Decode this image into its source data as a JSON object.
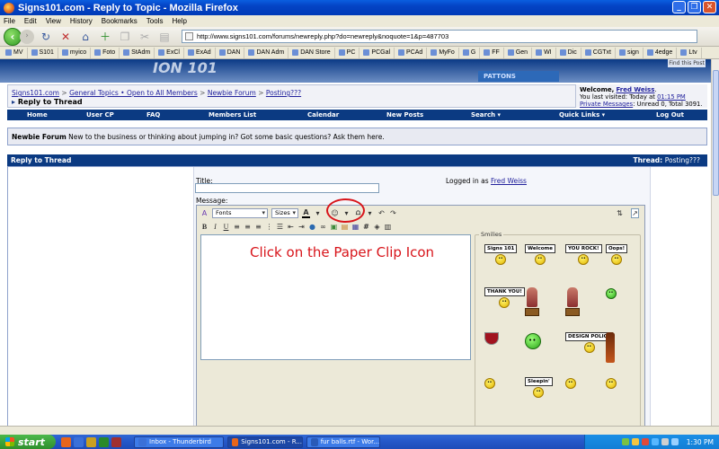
{
  "window": {
    "title": "Signs101.com - Reply to Topic - Mozilla Firefox"
  },
  "menubar": [
    "File",
    "Edit",
    "View",
    "History",
    "Bookmarks",
    "Tools",
    "Help"
  ],
  "navbar": {
    "url": "http://www.signs101.com/forums/newreply.php?do=newreply&noquote=1&p=487703"
  },
  "bookmarks": [
    "MV",
    "S101",
    "myico",
    "Foto",
    "StAdm",
    "ExCl",
    "ExAd",
    "DAN",
    "DAN Adm",
    "DAN Store",
    "PC",
    "PCGal",
    "PCAd",
    "MyFo",
    "G",
    "FF",
    "Gen",
    "WI",
    "Dic",
    "CGTxt",
    "sign",
    "4edge",
    "Ltv"
  ],
  "header": {
    "find_label": "Find this Post",
    "mid_label": "PATTONS"
  },
  "breadcrumb": {
    "items": [
      "Signs101.com",
      "General Topics • Open to All Members",
      "Newbie Forum",
      "Posting???"
    ],
    "separator": ">",
    "page_title": "Reply to Thread"
  },
  "welcome": {
    "greeting": "Welcome,",
    "user": "Fred Weiss",
    "last_visited_prefix": "You last visited: Today at",
    "last_visited_time": "01:15 PM",
    "pm_link": "Private Messages",
    "pm_counts": ": Unread 0, Total 3091."
  },
  "menu": [
    "Home",
    "User CP",
    "FAQ",
    "Members List",
    "Calendar",
    "New Posts",
    "Search ▾",
    "Quick Links ▾",
    "Log Out"
  ],
  "forum": {
    "name": "Newbie Forum",
    "description": "New to the business or thinking about jumping in? Got some basic questions? Ask them here."
  },
  "reply": {
    "bar_label": "Reply to Thread",
    "thread_label": "Thread:",
    "thread_name": "Posting???"
  },
  "form": {
    "title_label": "Title:",
    "message_label": "Message:",
    "logged_in_prefix": "Logged in as",
    "logged_in_user": "Fred Weiss"
  },
  "editor": {
    "fonts_label": "Fonts",
    "sizes_label": "Sizes",
    "smilies_legend": "Smilies"
  },
  "instruction": "Click on the Paper Clip Icon",
  "smilies": [
    {
      "sign": "Signs 101",
      "face": "yellow"
    },
    {
      "sign": "Welcome",
      "face": "yellow"
    },
    {
      "sign": "YOU ROCK!",
      "face": "yellow"
    },
    {
      "sign": "Oops!",
      "face": "yellow"
    },
    {
      "sign": "THANK YOU!",
      "face": "yellow"
    },
    {
      "sign": "",
      "face": "figure"
    },
    {
      "sign": "",
      "face": "figure"
    },
    {
      "sign": "",
      "face": "green"
    },
    {
      "sign": "",
      "face": "wine"
    },
    {
      "sign": "",
      "face": "greenbig"
    },
    {
      "sign": "DESIGN POLICE",
      "face": "yellow"
    },
    {
      "sign": "",
      "face": "bottle"
    },
    {
      "sign": "",
      "face": "yellow"
    },
    {
      "sign": "Sleepin'",
      "face": "yellow"
    },
    {
      "sign": "",
      "face": "yellow"
    },
    {
      "sign": "",
      "face": "yellow"
    }
  ],
  "taskbar": {
    "start_label": "start",
    "tasks": [
      "Inbox - Thunderbird",
      "Signs101.com - R...",
      "fur balls.rtf - Wor..."
    ],
    "clock": "1:30 PM"
  }
}
